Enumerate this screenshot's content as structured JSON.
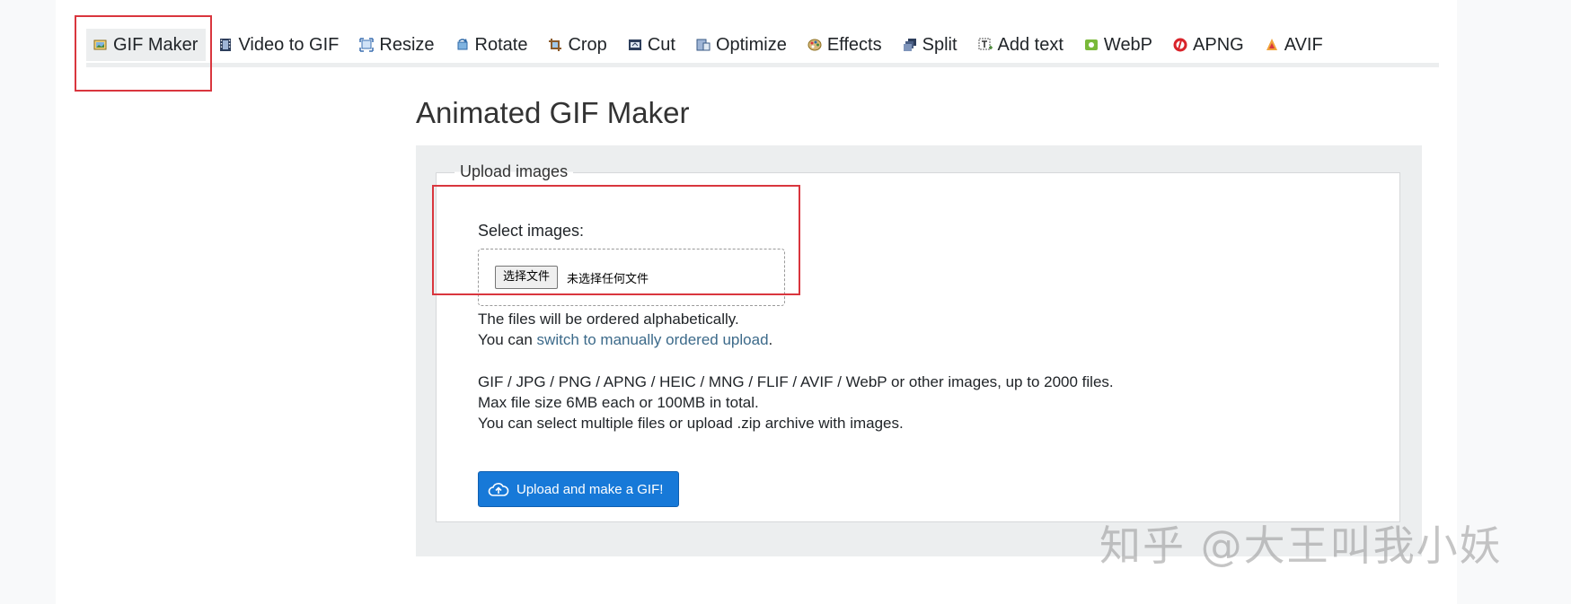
{
  "nav": {
    "tabs": [
      {
        "label": "GIF Maker",
        "icon": "gif-maker-icon",
        "active": true
      },
      {
        "label": "Video to GIF",
        "icon": "film-icon"
      },
      {
        "label": "Resize",
        "icon": "resize-icon"
      },
      {
        "label": "Rotate",
        "icon": "rotate-icon"
      },
      {
        "label": "Crop",
        "icon": "crop-icon"
      },
      {
        "label": "Cut",
        "icon": "cut-icon"
      },
      {
        "label": "Optimize",
        "icon": "optimize-icon"
      },
      {
        "label": "Effects",
        "icon": "palette-icon"
      },
      {
        "label": "Split",
        "icon": "split-icon"
      },
      {
        "label": "Add text",
        "icon": "add-text-icon"
      },
      {
        "label": "WebP",
        "icon": "webp-icon"
      },
      {
        "label": "APNG",
        "icon": "apng-icon"
      },
      {
        "label": "AVIF",
        "icon": "avif-icon"
      }
    ]
  },
  "page": {
    "title": "Animated GIF Maker"
  },
  "upload": {
    "legend": "Upload images",
    "select_label": "Select images:",
    "file_button": "选择文件",
    "file_status": "未选择任何文件",
    "order_note": "The files will be ordered alphabetically.",
    "switch_prefix": "You can ",
    "switch_link": "switch to manually ordered upload",
    "switch_suffix": ".",
    "formats": "GIF / JPG / PNG / APNG / HEIC / MNG / FLIF / AVIF / WebP or other images, up to 2000 files.",
    "max_size": "Max file size 6MB each or 100MB in total.",
    "multi_note": "You can select multiple files or upload .zip archive with images.",
    "submit_label": "Upload and make a GIF!"
  },
  "watermark": "知乎 @大王叫我小妖",
  "colors": {
    "accent": "#1779d8",
    "highlight": "#d9363e",
    "link": "#3c6a8a",
    "panel": "#eceeef"
  }
}
